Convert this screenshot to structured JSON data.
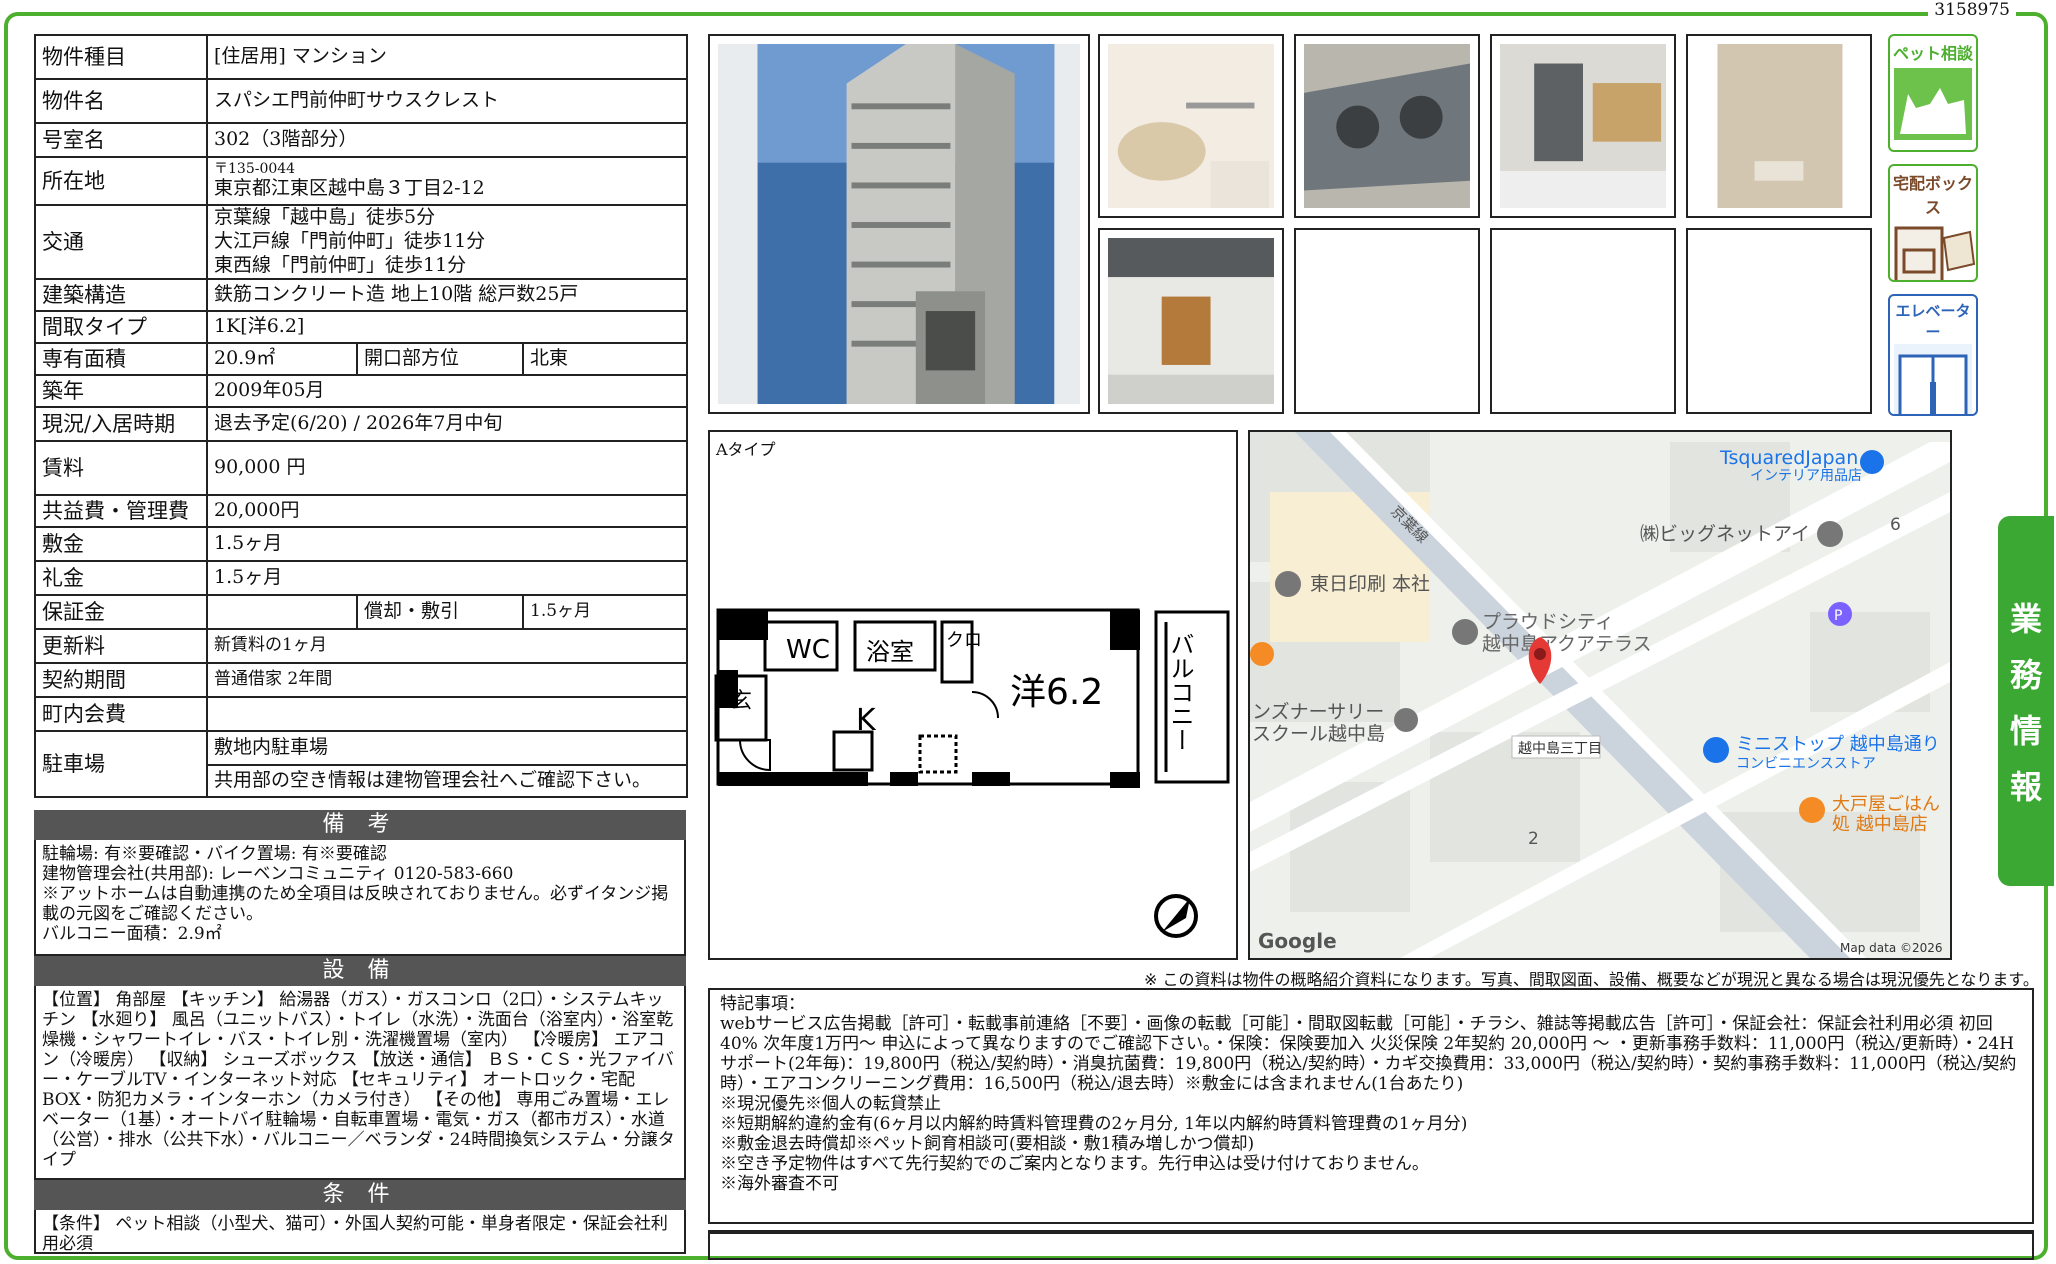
{
  "doc_id": "3158975",
  "property": {
    "type_label": "物件種目",
    "type_value": "[住居用] マンション",
    "name_label": "物件名",
    "name_value": "スパシエ門前仲町サウスクレスト",
    "room_label": "号室名",
    "room_value": "302（3階部分）",
    "address_label": "所在地",
    "postal": "〒135-0044",
    "address": "東京都江東区越中島３丁目2-12",
    "transport_label": "交通",
    "transport": [
      "京葉線「越中島」徒歩5分",
      "大江戸線「門前仲町」徒歩11分",
      "東西線「門前仲町」徒歩11分"
    ],
    "structure_label": "建築構造",
    "structure_value": "鉄筋コンクリート造 地上10階 総戸数25戸",
    "layout_label": "間取タイプ",
    "layout_value": "1K[洋6.2]",
    "area_label": "専有面積",
    "area_value": "20.9㎡",
    "direction_label": "開口部方位",
    "direction_value": "北東",
    "built_label": "築年",
    "built_value": "2009年05月",
    "status_label": "現況/入居時期",
    "status_value": "退去予定(6/20)  /  2026年7月中旬",
    "rent_label": "賃料",
    "rent_value": "90,000 円",
    "fee_label": "共益費・管理費",
    "fee_value": "20,000円",
    "deposit_label": "敷金",
    "deposit_value": "1.5ヶ月",
    "key_money_label": "礼金",
    "key_money_value": "1.5ヶ月",
    "guarantee_label": "保証金",
    "guarantee_value": "",
    "amort_label": "償却・敷引",
    "amort_value": "1.5ヶ月",
    "renewal_label": "更新料",
    "renewal_value": "新賃料の1ヶ月",
    "contract_label": "契約期間",
    "contract_value": "普通借家 2年間",
    "community_label": "町内会費",
    "community_value": "",
    "parking_label": "駐車場",
    "parking_value": "敷地内駐車場",
    "parking_note": "共用部の空き情報は建物管理会社へご確認下さい。"
  },
  "remarks": {
    "title": "備 考",
    "lines": [
      "駐輪場: 有※要確認・バイク置場: 有※要確認",
      "建物管理会社(共用部): レーベンコミュニティ   0120-583-660",
      "※アットホームは自動連携のため全項目は反映されておりません。必ずイタンジ掲載の元図をご確認ください。",
      "バルコニー面積：2.9㎡"
    ]
  },
  "equipment": {
    "title": "設 備",
    "text": "【位置】 角部屋 【キッチン】 給湯器（ガス）・ガスコンロ（2口）・システムキッチン 【水廻り】 風呂（ユニットバス）・トイレ（水洗）・洗面台（浴室内）・浴室乾燥機・シャワートイレ・バス・トイレ別・洗濯機置場（室内） 【冷暖房】 エアコン（冷暖房） 【収納】 シューズボックス 【放送・通信】 ＢＳ・ＣＳ・光ファイバー・ケーブルTV・インターネット対応 【セキュリティ】 オートロック・宅配BOX・防犯カメラ・インターホン（カメラ付き） 【その他】 専用ごみ置場・エレベーター（1基）・オートバイ駐輪場・自転車置場・電気・ガス（都市ガス）・水道（公営）・排水（公共下水）・バルコニー／ベランダ・24時間換気システム・分譲タイプ"
  },
  "conditions": {
    "title": "条 件",
    "text": "【条件】 ペット相談（小型犬、猫可）・外国人契約可能・単身者限定・保証会社利用必須"
  },
  "features": [
    "ペット相談",
    "宅配ボックス",
    "エレベーター"
  ],
  "side_tab": [
    "業",
    "務",
    "情",
    "報"
  ],
  "floorplan": {
    "label": "Aタイプ",
    "rooms": {
      "wc": "WC",
      "bath": "浴室",
      "closet": "クロ",
      "room": "洋6.2",
      "kitchen": "K",
      "entrance": "玄",
      "balcony": "バルコニー"
    }
  },
  "map": {
    "places": {
      "tsquared": "TsquaredJapan",
      "tsquared_sub": "インテリア用品店",
      "bignet": "㈱ビッグネットアイ",
      "tonichi": "東日印刷 本社",
      "proud1": "プラウドシティ",
      "proud2": "越中島アクアテラス",
      "nursery1": "ンズナーサリー",
      "nursery2": "スクール越中島",
      "ministop": "ミニストップ 越中島通り",
      "ministop_sub": "コンビニエンスストア",
      "ootoya1": "大戸屋ごはん",
      "ootoya2": "処 越中島店",
      "crossing": "越中島三丁目",
      "line": "京葉線",
      "num6": "6",
      "num2": "2",
      "parking": "P"
    },
    "google": "Google",
    "attribution": "Map data ©2026"
  },
  "disclaimer": "※ この資料は物件の概略紹介資料になります。写真、間取図面、設備、概要などが現況と異なる場合は現況優先となります。",
  "special": {
    "title": "特記事項：",
    "lines": [
      "webサービス広告掲載［許可］・転載事前連絡［不要］・画像の転載［可能］・間取図転載［可能］・チラシ、雑誌等掲載広告［許可］・保証会社：保証会社利用必須 初回40% 次年度1万円〜 申込によって異なりますのでご確認下さい。・保険：保険要加入 火災保険 2年契約 20,000円 〜 ・更新事務手数料：11,000円（税込/更新時）・24Hサポート(2年毎)：19,800円（税込/契約時）・消臭抗菌費：19,800円（税込/契約時）・カギ交換費用：33,000円（税込/契約時）・契約事務手数料：11,000円（税込/契約時）・エアコンクリーニング費用：16,500円（税込/退去時）※敷金には含まれません(1台あたり)",
      "※現況優先※個人の転貸禁止",
      "※短期解約違約金有(6ヶ月以内解約時賃料管理費の2ヶ月分, 1年以内解約時賃料管理費の1ヶ月分)",
      "※敷金退去時償却※ペット飼育相談可(要相談・敷1積み増しかつ償却)",
      "※空き予定物件はすべて先行契約でのご案内となります。先行申込は受け付けておりません。",
      "※海外審査不可"
    ]
  },
  "colors": {
    "accent": "#4caf2e",
    "bar": "#555555",
    "pin": "#e53935"
  }
}
